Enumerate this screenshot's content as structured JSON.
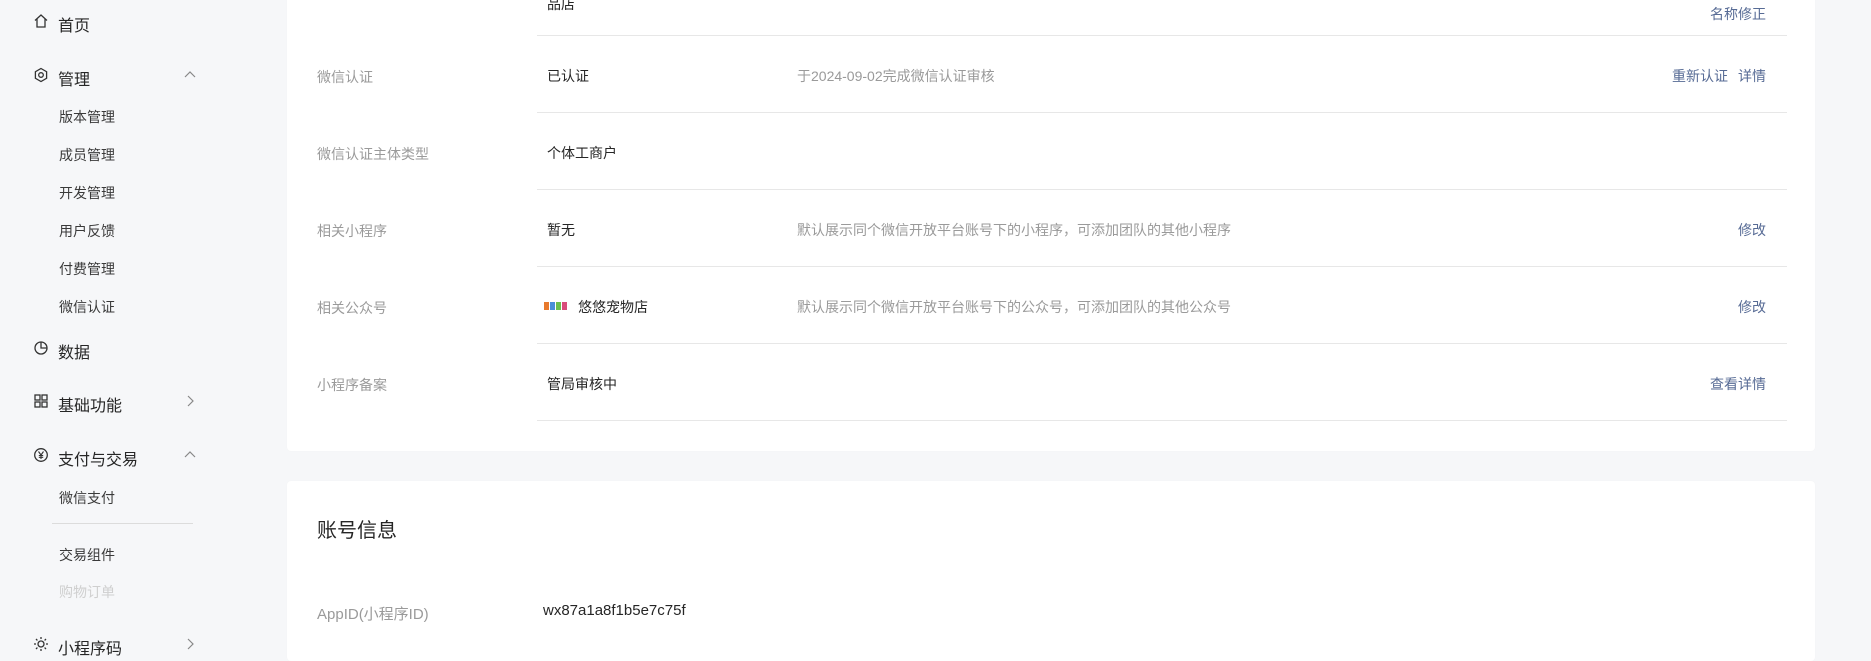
{
  "sidebar": {
    "home_label": "首页",
    "manage_label": "管理",
    "manage_items": [
      "版本管理",
      "成员管理",
      "开发管理",
      "用户反馈",
      "付费管理",
      "微信认证"
    ],
    "data_label": "数据",
    "basic_label": "基础功能",
    "pay_label": "支付与交易",
    "pay_items": [
      "微信支付",
      "交易组件",
      "购物订单"
    ],
    "qrcode_label": "小程序码"
  },
  "info": {
    "top_partial_value": "品店",
    "top_action": "名称修正",
    "rows": [
      {
        "label": "微信认证",
        "value": "已认证",
        "desc": "于2024-09-02完成微信认证审核",
        "actions": [
          "重新认证",
          "详情"
        ]
      },
      {
        "label": "微信认证主体类型",
        "value": "个体工商户",
        "desc": "",
        "actions": []
      },
      {
        "label": "相关小程序",
        "value": "暂无",
        "desc": "默认展示同个微信开放平台账号下的小程序，可添加团队的其他小程序",
        "actions": [
          "修改"
        ]
      },
      {
        "label": "相关公众号",
        "value": "悠悠宠物店",
        "desc": "默认展示同个微信开放平台账号下的公众号，可添加团队的其他公众号",
        "actions": [
          "修改"
        ]
      },
      {
        "label": "小程序备案",
        "value": "管局审核中",
        "desc": "",
        "actions": [
          "查看详情"
        ]
      }
    ]
  },
  "account": {
    "title": "账号信息",
    "appid_label": "AppID(小程序ID)",
    "appid_value": "wx87a1a8f1b5e7c75f"
  },
  "colors": {
    "link": "#576b95",
    "label_gray": "#9a9a9a",
    "background": "#f6f7f9"
  }
}
